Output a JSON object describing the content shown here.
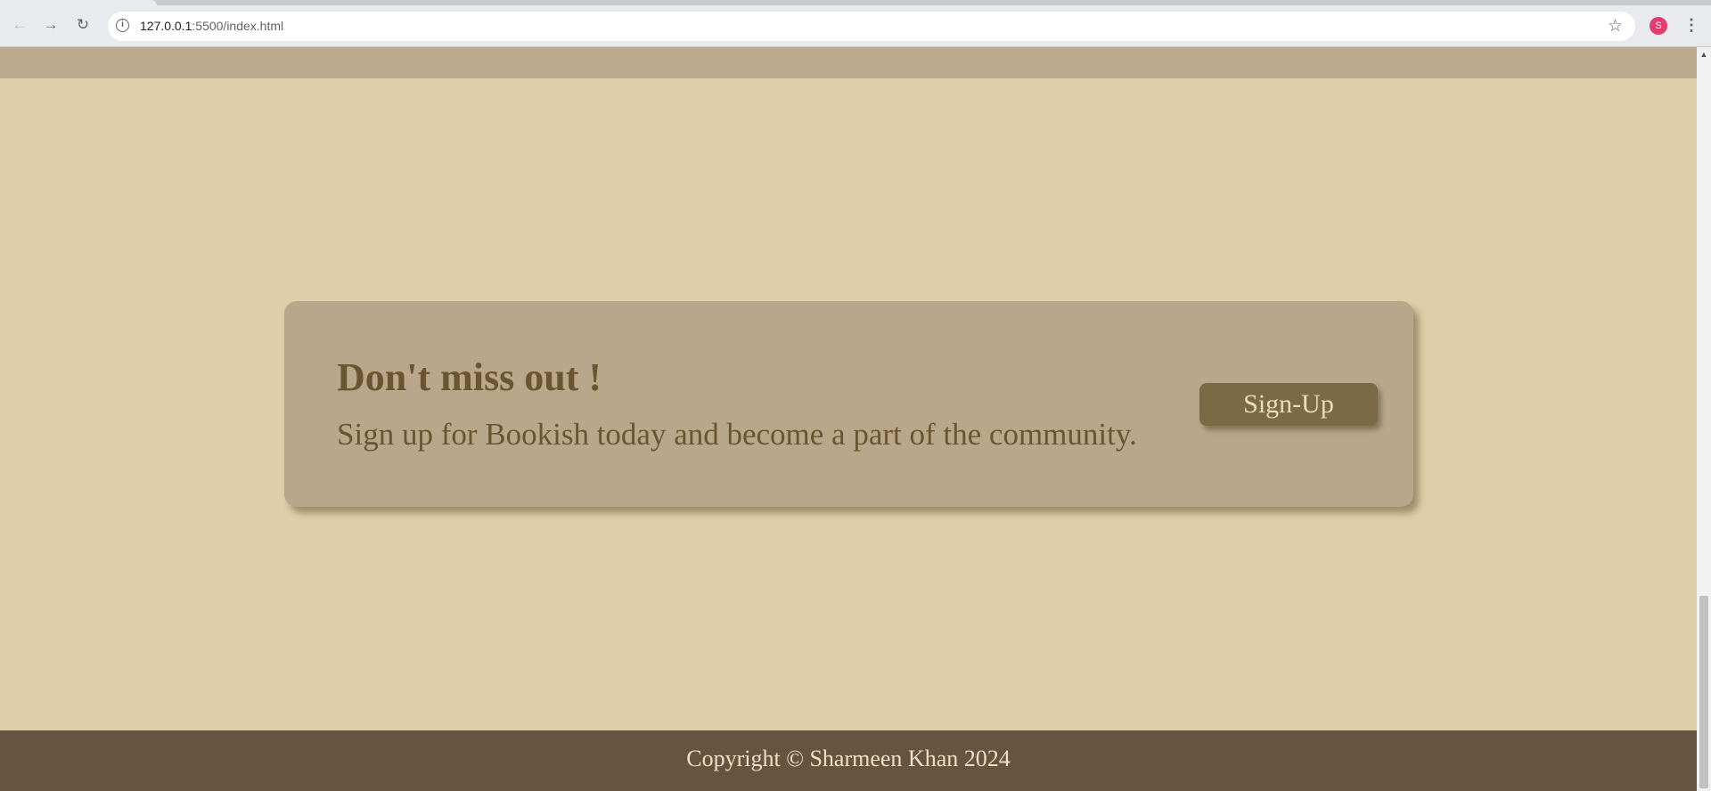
{
  "browser": {
    "url_host": "127.0.0.1",
    "url_path": ":5500/index.html",
    "back_icon": "←",
    "forward_icon": "→",
    "reload_icon": "↻",
    "info_icon": "i",
    "bookmark_icon": "☆",
    "profile_initial": "S",
    "menu_icon": "⋮"
  },
  "cta": {
    "title": "Don't miss out !",
    "subtitle": "Sign up for Bookish today and become a part of the community.",
    "button_label": "Sign-Up"
  },
  "footer": {
    "copyright": "Copyright ©  Sharmeen Khan 2024"
  },
  "colors": {
    "page_background": "#dfcea9",
    "card_background": "#b8a78a",
    "text_brown": "#6a5530",
    "button_background": "#7c6945",
    "footer_background": "#665440"
  },
  "scrollbar": {
    "scroll_up_icon": "▲"
  }
}
